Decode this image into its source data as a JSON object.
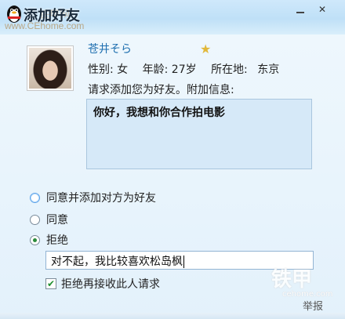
{
  "window": {
    "title": "添加好友",
    "watermark_site": "www.CEhome.com",
    "watermark_mark": "铁甲网"
  },
  "profile": {
    "nickname": "苍井そら",
    "gender_label": "性别: 女",
    "age_label": "年龄: 27岁",
    "location_label": "所在地:",
    "location_value": "东京"
  },
  "request": {
    "label": "请求添加您为好友。附加信息:",
    "message": "你好，我想和你合作拍电影"
  },
  "options": [
    {
      "label": "同意并添加对方为好友",
      "selected": false
    },
    {
      "label": "同意",
      "selected": false
    },
    {
      "label": "拒绝",
      "selected": true
    }
  ],
  "reply": {
    "value": "对不起，我比较喜欢松岛枫"
  },
  "block_checkbox": {
    "label": "拒绝再接收此人请求",
    "checked": true
  },
  "footer": {
    "report_label": "举报",
    "watermark": "铁甲",
    "watermark_sub": "cehome.com"
  },
  "icons": {
    "app": "qq-penguin-icon",
    "star": "star-icon"
  }
}
